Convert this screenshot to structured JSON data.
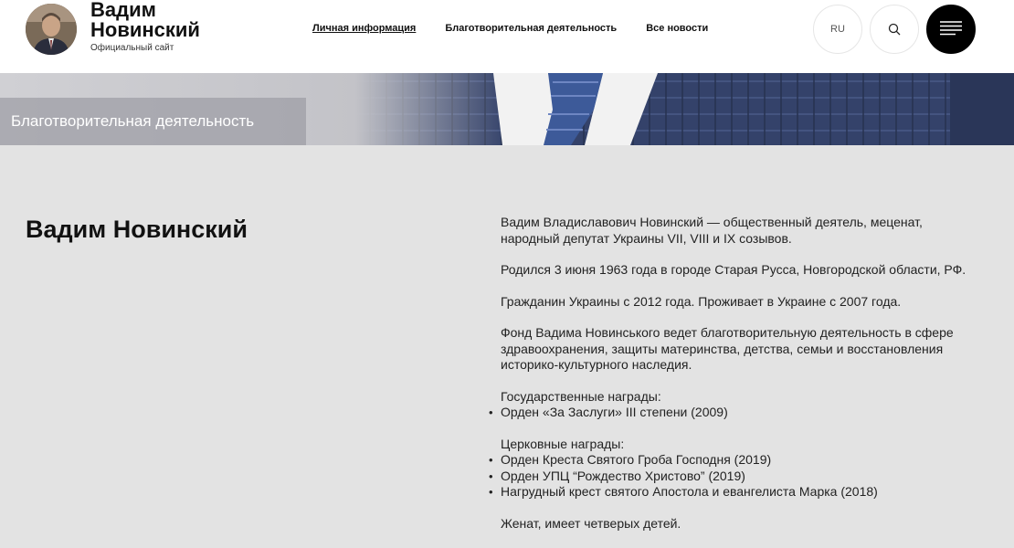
{
  "header": {
    "site_name": "Вадим Новинский",
    "site_subtitle": "Официальный сайт",
    "nav": [
      {
        "label": "Личная информация",
        "active": true
      },
      {
        "label": "Благотворительная деятельность",
        "active": false
      },
      {
        "label": "Все новости",
        "active": false
      }
    ],
    "lang": "RU"
  },
  "banner": {
    "label": "Благотворительная деятельность"
  },
  "main": {
    "title": "Вадим Новинский",
    "paragraphs": [
      "Вадим Владиславович Новинский — общественный деятель, меценат, народный депутат Украины VII, VIII и IX созывов.",
      "Родился 3 июня 1963 года в городе Старая Русса, Новгородской области, РФ.",
      "Гражданин Украины с 2012 года. Проживает в Украине с 2007 года.",
      "Фонд Вадима Новинського ведет благотворительную деятельность в сфере здравоохранения, защиты материнства, детства, семьи и восстановления историко-культурного наследия."
    ],
    "state_awards_heading": "Государственные награды:",
    "state_awards": [
      "Орден «За Заслуги» III степени (2009)"
    ],
    "church_awards_heading": "Церковные награды:",
    "church_awards": [
      "Орден Креста Святого Гроба Господня (2019)",
      "Орден УПЦ “Рождество Христово” (2019)",
      "Нагрудный крест святого Апостола и евангелиста Марка (2018)"
    ],
    "family": "Женат, имеет четверых детей."
  },
  "colors": {
    "background": "#e3e3e3",
    "header_bg": "#ffffff",
    "menu_button": "#000000",
    "banner_suit": "#2f3b5c"
  },
  "icons": {
    "search": "search-icon",
    "menu": "hamburger-menu-icon"
  }
}
